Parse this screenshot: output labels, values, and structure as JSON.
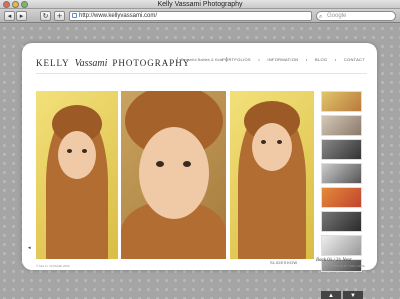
{
  "window": {
    "title": "Kelly Vassami Photography"
  },
  "toolbar": {
    "back_glyph": "◂",
    "forward_glyph": "▸",
    "reload_glyph": "↻",
    "add_glyph": "+",
    "url": "http://www.kellyvassami.com/",
    "search_placeholder": "Google"
  },
  "site": {
    "logo_part1": "KELLY",
    "logo_part2": "Vassami",
    "logo_part3": "PHOTOGRAPHY",
    "tagline": "Beautiful Babies & Kids",
    "nav": [
      "PORTFOLIOS",
      "INFORMATION",
      "BLOG",
      "CONTACT"
    ],
    "nav_separator": "•",
    "slideshow_label": "SLIDESHOW",
    "counter_back": "Back",
    "counter_text": "01 / 21",
    "counter_next": "Next",
    "left_arrow": "◂",
    "copyright": "© KELLY VASSAMI 2009",
    "credit": "WEBSITE BY SITE NAME",
    "pager_up": "▲",
    "pager_down": "▼"
  },
  "colors": {
    "accent_towel": "#b26d32",
    "background_yellow": "#e8d060"
  }
}
